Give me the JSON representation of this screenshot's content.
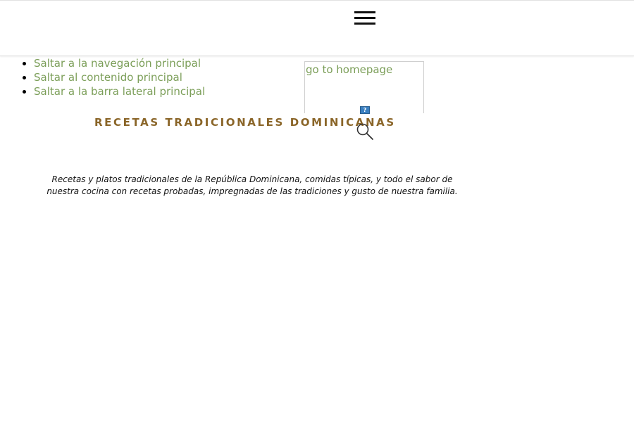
{
  "header": {
    "menu_icon": "hamburger-menu-icon"
  },
  "skip_links": [
    {
      "label": "Saltar a la navegación principal"
    },
    {
      "label": "Saltar al contenido principal"
    },
    {
      "label": "Saltar a la barra lateral principal"
    }
  ],
  "logo": {
    "alt_text": "go to homepage",
    "broken_icon_glyph": "?"
  },
  "site": {
    "title": "RECETAS TRADICIONALES DOMINICANAS",
    "description": "Recetas y platos tradicionales de la República Dominicana, comidas típicas, y todo el sabor de nuestra cocina con recetas probadas, impregnadas de las tradiciones y gusto de nuestra familia.",
    "search_icon": "search-icon"
  },
  "colors": {
    "link": "#7b9e58",
    "title": "#8a6528",
    "text": "#111111"
  }
}
